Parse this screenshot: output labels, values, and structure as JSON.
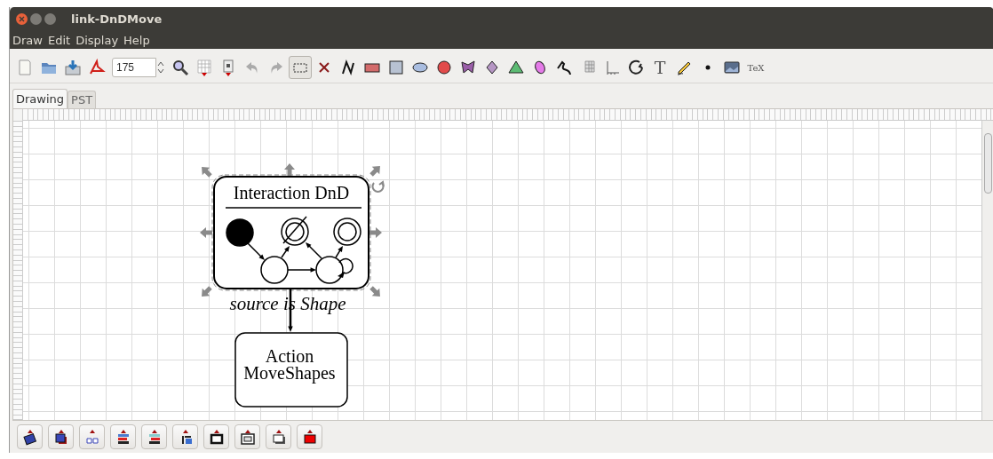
{
  "window": {
    "title": "link-DnDMove"
  },
  "menu": [
    "Draw",
    "Edit",
    "Display",
    "Help"
  ],
  "toolbar": {
    "zoom": "175",
    "tools": [
      {
        "kind": "new",
        "selected": false
      },
      {
        "kind": "open",
        "selected": false
      },
      {
        "kind": "import",
        "selected": false
      },
      {
        "kind": "pdf",
        "selected": false
      },
      {
        "kind": "zoomfield"
      },
      {
        "kind": "magnifier",
        "selected": false
      },
      {
        "kind": "grid",
        "selected": false
      },
      {
        "kind": "template",
        "selected": false
      },
      {
        "kind": "undo",
        "selected": false
      },
      {
        "kind": "redo",
        "selected": false
      },
      {
        "kind": "select",
        "selected": true
      },
      {
        "kind": "delete",
        "selected": false
      },
      {
        "kind": "polyline",
        "selected": false
      },
      {
        "kind": "rect",
        "selected": false
      },
      {
        "kind": "square",
        "selected": false
      },
      {
        "kind": "ellipse",
        "selected": false
      },
      {
        "kind": "circle",
        "selected": false
      },
      {
        "kind": "polygon",
        "selected": false
      },
      {
        "kind": "diamond",
        "selected": false
      },
      {
        "kind": "triangle",
        "selected": false
      },
      {
        "kind": "blob",
        "selected": false
      },
      {
        "kind": "curve",
        "selected": false
      },
      {
        "kind": "gridshape",
        "selected": false
      },
      {
        "kind": "axes",
        "selected": false
      },
      {
        "kind": "arc",
        "selected": false
      },
      {
        "kind": "text",
        "label": "T",
        "selected": false
      },
      {
        "kind": "pencil",
        "selected": false
      },
      {
        "kind": "dot",
        "selected": false
      },
      {
        "kind": "picture",
        "selected": false
      },
      {
        "kind": "tex",
        "label": "TeX",
        "selected": false
      }
    ]
  },
  "tabs": [
    {
      "label": "Drawing",
      "selected": true
    },
    {
      "label": "PST",
      "selected": false
    }
  ],
  "diagram": {
    "interaction": {
      "title": "Interaction DnD",
      "selected": true
    },
    "link_label": "source is Shape",
    "action": {
      "lines": [
        "Action",
        "MoveShapes"
      ]
    }
  },
  "bottom_toolbar": [
    {
      "kind": "rotate"
    },
    {
      "kind": "front"
    },
    {
      "kind": "distribute"
    },
    {
      "kind": "align-left"
    },
    {
      "kind": "align-right"
    },
    {
      "kind": "mirror"
    },
    {
      "kind": "border"
    },
    {
      "kind": "double-border"
    },
    {
      "kind": "shadow"
    },
    {
      "kind": "fill"
    }
  ]
}
